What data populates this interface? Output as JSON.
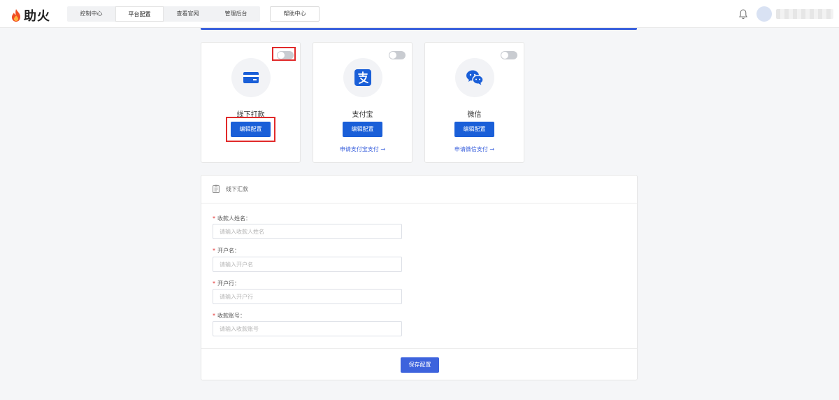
{
  "header": {
    "logo_text": "助火",
    "nav": [
      "控制中心",
      "平台配置",
      "查看官网",
      "管理后台"
    ],
    "help_label": "帮助中心"
  },
  "cards": [
    {
      "title": "线下打款",
      "edit_label": "编辑配置",
      "link": "",
      "enabled": false
    },
    {
      "title": "支付宝",
      "edit_label": "编辑配置",
      "link": "申请支付宝支付 →",
      "enabled": false
    },
    {
      "title": "微信",
      "edit_label": "编辑配置",
      "link": "申请微信支付 →",
      "enabled": false
    }
  ],
  "form": {
    "title": "线下汇款",
    "fields": [
      {
        "label": "收款人姓名：",
        "placeholder": "请输入收款人姓名"
      },
      {
        "label": "开户名：",
        "placeholder": "请输入开户名"
      },
      {
        "label": "开户行：",
        "placeholder": "请输入开户行"
      },
      {
        "label": "收款账号：",
        "placeholder": "请输入收款账号"
      }
    ],
    "required_mark": "*",
    "save_label": "保存配置"
  },
  "colors": {
    "primary": "#1a5fd8",
    "accent": "#3d63dd",
    "highlight": "#e12a2a"
  }
}
